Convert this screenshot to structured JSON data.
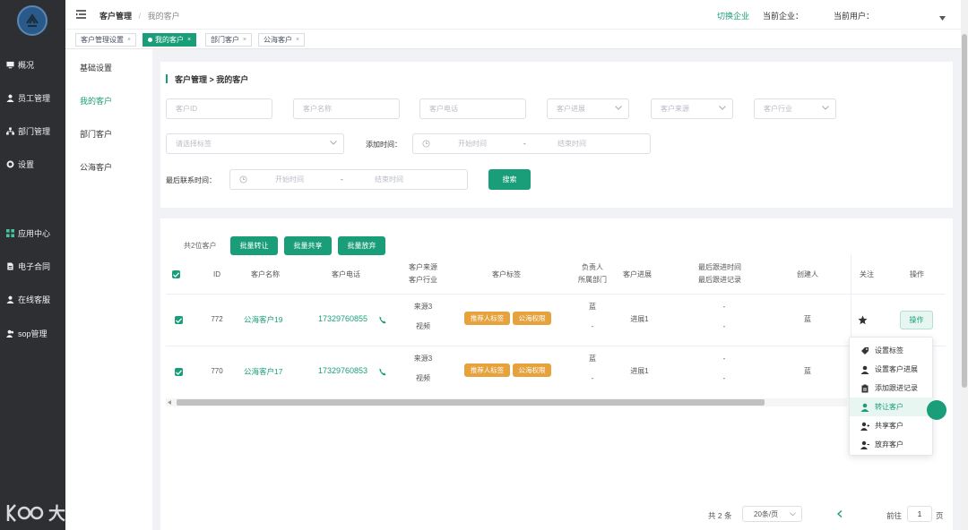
{
  "sidebar": {
    "items": [
      {
        "label": "概况",
        "icon": "monitor-icon"
      },
      {
        "label": "员工管理",
        "icon": "user-icon"
      },
      {
        "label": "部门管理",
        "icon": "org-icon"
      },
      {
        "label": "设置",
        "icon": "gear-icon"
      },
      {
        "label": "应用中心",
        "icon": "grid-icon"
      },
      {
        "label": "电子合同",
        "icon": "document-icon"
      },
      {
        "label": "在线客服",
        "icon": "user-icon"
      },
      {
        "label": "sop管理",
        "icon": "user-group-icon"
      }
    ],
    "watermark": "大数跨境"
  },
  "header": {
    "breadcrumb": [
      "客户管理",
      "我的客户"
    ],
    "separator": "/",
    "switch_company": "切换企业",
    "current_company_label": "当前企业：",
    "current_user_label": "当前用户："
  },
  "tabs": [
    {
      "label": "客户管理设置",
      "active": false
    },
    {
      "label": "我的客户",
      "active": true
    },
    {
      "label": "部门客户",
      "active": false
    },
    {
      "label": "公海客户",
      "active": false
    }
  ],
  "submenu": [
    "基础设置",
    "我的客户",
    "部门客户",
    "公海客户"
  ],
  "filter": {
    "title": "客户管理 > 我的客户",
    "customer_id_placeholder": "客户ID",
    "customer_name_placeholder": "客户名称",
    "customer_phone_placeholder": "客户电话",
    "customer_progress_placeholder": "客户进展",
    "customer_source_placeholder": "客户来源",
    "customer_industry_placeholder": "客户行业",
    "tag_placeholder": "请选择标签",
    "add_time_label": "添加时间：",
    "last_contact_label": "最后联系时间：",
    "start_placeholder": "开始时间",
    "end_placeholder": "结束时间",
    "range_sep": "-",
    "search_button": "搜索"
  },
  "toolbar": {
    "count_text": "共2位客户",
    "batch_transfer": "批量转让",
    "batch_share": "批量共享",
    "batch_abandon": "批量放弃"
  },
  "table": {
    "headers": {
      "id": "ID",
      "name": "客户名称",
      "phone": "客户电话",
      "source_1": "客户来源",
      "source_2": "客户行业",
      "tags": "客户标签",
      "owner_1": "负责人",
      "owner_2": "所属部门",
      "progress": "客户进展",
      "follow_1": "最后跟进时间",
      "follow_2": "最后跟进记录",
      "creator": "创建人",
      "star": "关注",
      "action": "操作"
    },
    "rows": [
      {
        "id": "772",
        "name": "公海客户19",
        "phone": "17329760855",
        "source": "来源3",
        "industry": "视频",
        "tags": [
          "推荐人标签",
          "公海权限"
        ],
        "owner": "蓝",
        "dept": "-",
        "progress": "进展1",
        "follow_time": "-",
        "follow_record": "-",
        "creator": "蓝",
        "action": "操作"
      },
      {
        "id": "770",
        "name": "公海客户17",
        "phone": "17329760853",
        "source": "来源3",
        "industry": "视频",
        "tags": [
          "推荐人标签",
          "公海权限"
        ],
        "owner": "蓝",
        "dept": "-",
        "progress": "进展1",
        "follow_time": "-",
        "follow_record": "-",
        "creator": "蓝",
        "action": ""
      }
    ]
  },
  "action_menu": [
    {
      "label": "设置标签",
      "icon": "tag-icon"
    },
    {
      "label": "设置客户进展",
      "icon": "user-icon"
    },
    {
      "label": "添加跟进记录",
      "icon": "clipboard-icon"
    },
    {
      "label": "转让客户",
      "icon": "user-icon",
      "highlighted": true
    },
    {
      "label": "共享客户",
      "icon": "user-share-icon"
    },
    {
      "label": "放弃客户",
      "icon": "user-remove-icon"
    }
  ],
  "pagination": {
    "total": "共 2 条",
    "page_size": "20条/页",
    "goto_label": "前往",
    "page": "1",
    "page_unit": "页"
  },
  "colors": {
    "brand": "#1a9e7a",
    "tag": "#e6a23c",
    "sidebar": "#2e2f33"
  }
}
